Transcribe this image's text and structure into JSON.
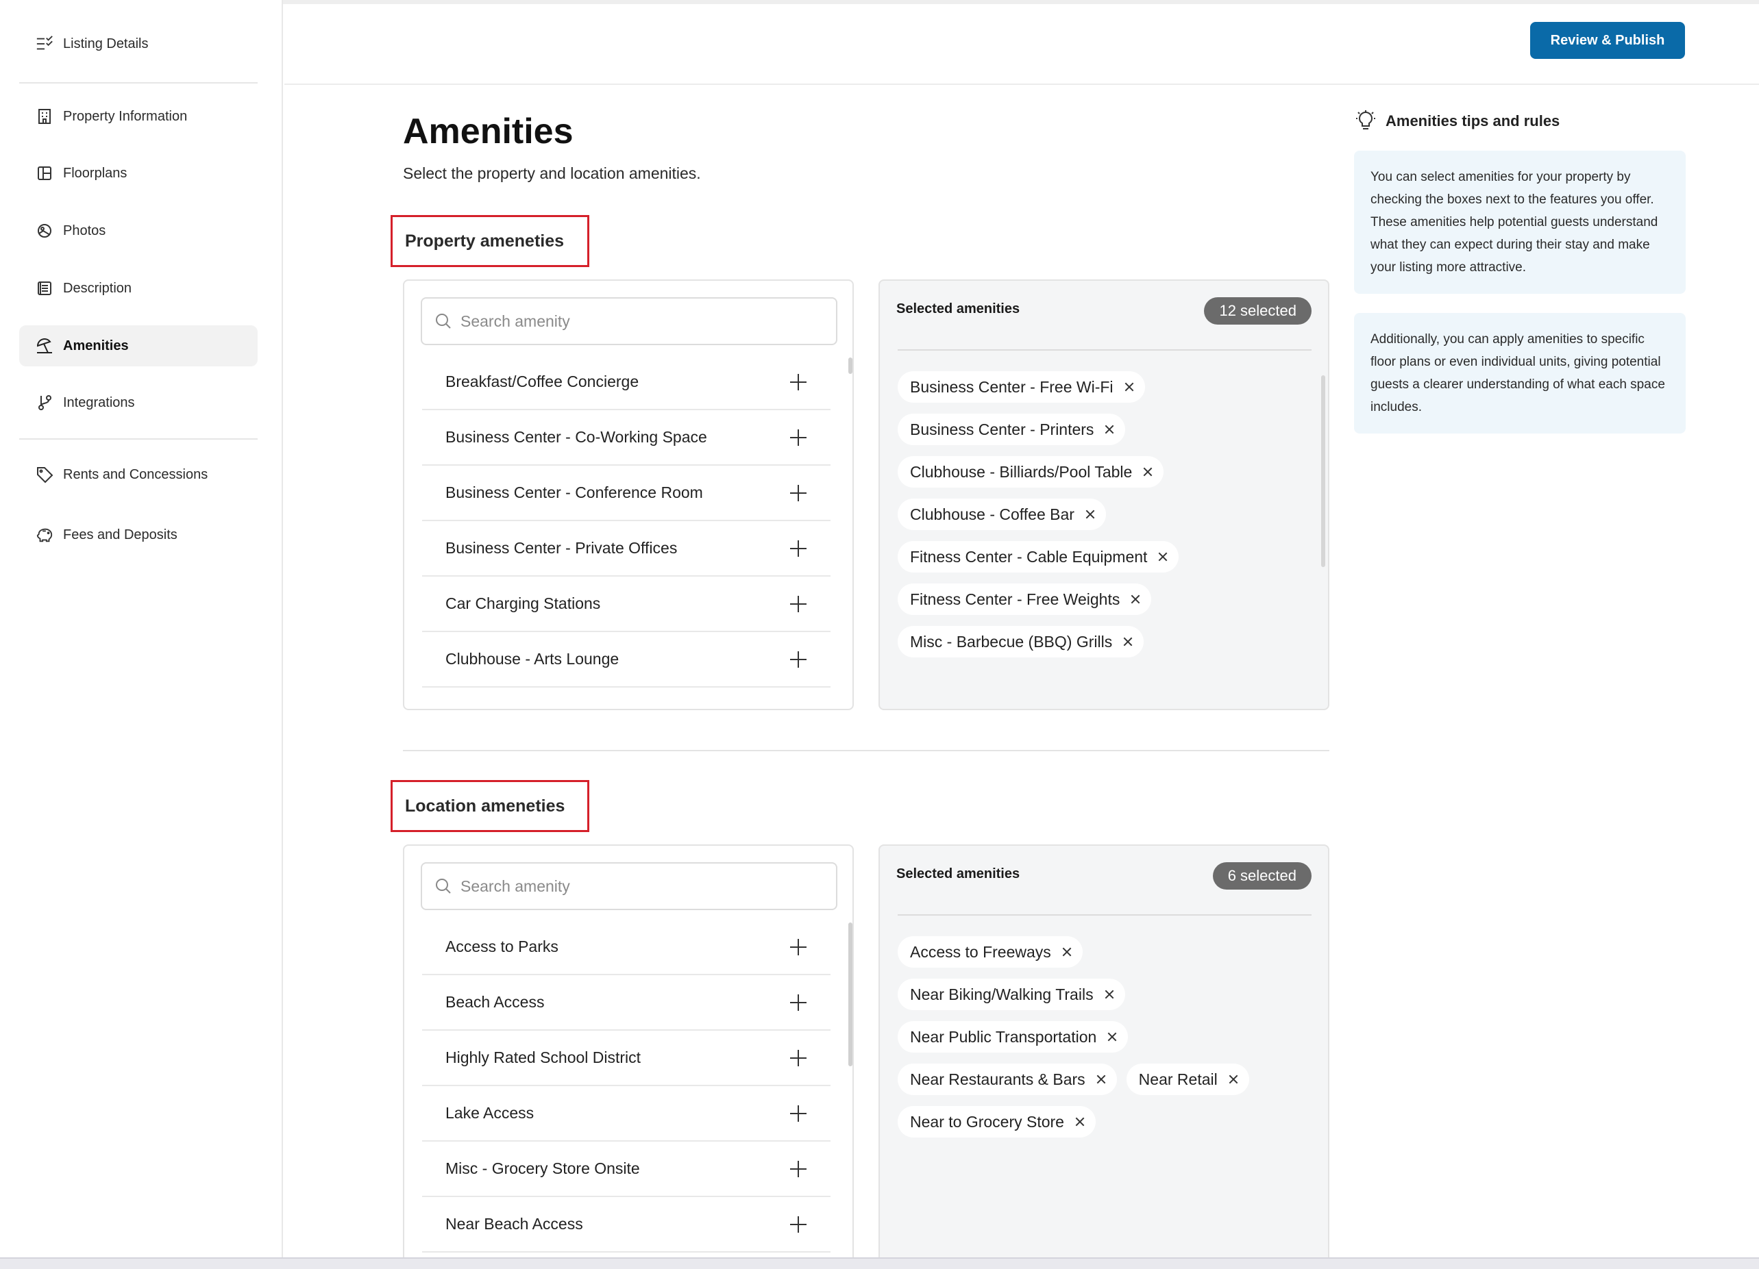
{
  "sidebar": {
    "items": [
      {
        "label": "Listing Details",
        "icon": "checklist-icon",
        "active": false
      },
      {
        "label": "Property Information",
        "icon": "building-icon",
        "active": false
      },
      {
        "label": "Floorplans",
        "icon": "floorplan-icon",
        "active": false
      },
      {
        "label": "Photos",
        "icon": "photo-icon",
        "active": false
      },
      {
        "label": "Description",
        "icon": "document-icon",
        "active": false
      },
      {
        "label": "Amenities",
        "icon": "beach-umbrella-icon",
        "active": true
      },
      {
        "label": "Integrations",
        "icon": "branch-icon",
        "active": false
      },
      {
        "label": "Rents and Concessions",
        "icon": "tag-icon",
        "active": false
      },
      {
        "label": "Fees and Deposits",
        "icon": "piggy-bank-icon",
        "active": false
      }
    ]
  },
  "header": {
    "publish_label": "Review & Publish",
    "accent": "#0a6aa8"
  },
  "main": {
    "title": "Amenities",
    "subtitle": "Select the property and location amenities."
  },
  "property": {
    "heading": "Property ameneties",
    "search_placeholder": "Search amenity",
    "available": [
      "Breakfast/Coffee Concierge",
      "Business Center - Co-Working Space",
      "Business Center - Conference Room",
      "Business Center - Private Offices",
      "Car Charging Stations",
      "Clubhouse - Arts Lounge"
    ],
    "selected_title": "Selected amenities",
    "selected_count": "12 selected",
    "selected": [
      "Business Center - Free Wi-Fi",
      "Business Center - Printers",
      "Clubhouse - Billiards/Pool Table",
      "Clubhouse - Coffee Bar",
      "Fitness Center - Cable Equipment",
      "Fitness Center - Free Weights",
      "Misc - Barbecue (BBQ) Grills"
    ]
  },
  "location": {
    "heading": "Location ameneties",
    "search_placeholder": "Search amenity",
    "available": [
      "Access to Parks",
      "Beach Access",
      "Highly Rated School District",
      "Lake Access",
      "Misc - Grocery Store Onsite",
      "Near Beach Access"
    ],
    "selected_title": "Selected amenities",
    "selected_count": "6 selected",
    "selected": [
      "Access to Freeways",
      "Near Biking/Walking Trails",
      "Near Public Transportation",
      "Near Restaurants & Bars",
      "Near Retail",
      "Near to Grocery Store"
    ]
  },
  "tips": {
    "title": "Amenities tips and rules",
    "paragraphs": [
      "You can select amenities for your property by checking the boxes next to the features you offer. These amenities help potential guests understand what they can expect during their stay and make your listing more attractive.",
      "Additionally, you can apply amenities to specific floor plans or even individual units, giving potential guests a clearer understanding of what each space includes."
    ]
  }
}
